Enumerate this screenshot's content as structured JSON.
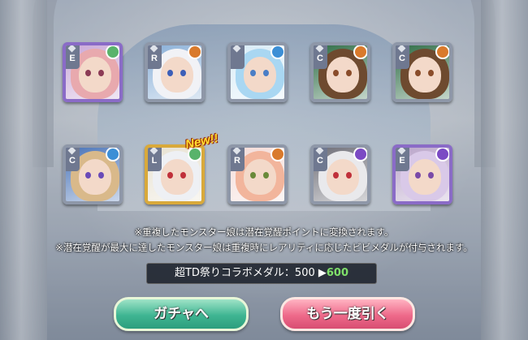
{
  "cards": [
    {
      "rarity": "E",
      "element": "wind",
      "frame": "purple",
      "hair": "#e8a9ae",
      "eye": "#8b3a55",
      "bg": "#c9a8d8",
      "elem_color": "#59b36b"
    },
    {
      "rarity": "R",
      "element": "earth",
      "frame": "silver",
      "hair": "#f1f2f6",
      "eye": "#3c5fb8",
      "bg": "#8ab0d8",
      "elem_color": "#d97a2c"
    },
    {
      "rarity": "",
      "element": "water",
      "frame": "silver",
      "hair": "#a9d7f2",
      "eye": "#4a7ec6",
      "bg": "#d9ecf7",
      "elem_color": "#3c8fd6"
    },
    {
      "rarity": "C",
      "element": "earth",
      "frame": "silver",
      "hair": "#6e4a2f",
      "eye": "#8a4c2a",
      "bg": "#2f6d46",
      "elem_color": "#d97a2c"
    },
    {
      "rarity": "C",
      "element": "earth",
      "frame": "silver",
      "hair": "#6e4a2f",
      "eye": "#8a4c2a",
      "bg": "#2f6d46",
      "elem_color": "#d97a2c"
    },
    {
      "rarity": "C",
      "element": "water",
      "frame": "silver",
      "hair": "#d9b98a",
      "eye": "#6a4ab8",
      "bg": "#4a74b8",
      "elem_color": "#3c8fd6"
    },
    {
      "rarity": "L",
      "element": "wind",
      "frame": "gold",
      "hair": "#eef0f4",
      "eye": "#c0303a",
      "bg": "#e8e2d2",
      "elem_color": "#59b36b"
    },
    {
      "rarity": "R",
      "element": "earth",
      "frame": "silver",
      "hair": "#f2b59c",
      "eye": "#6a8a3a",
      "bg": "#f4dcd8",
      "elem_color": "#d97a2c"
    },
    {
      "rarity": "C",
      "element": "dark",
      "frame": "silver",
      "hair": "#e9e9ec",
      "eye": "#c0303a",
      "bg": "#6f6f78",
      "elem_color": "#7b4ac4"
    },
    {
      "rarity": "E",
      "element": "dark",
      "frame": "purple",
      "hair": "#d9c9e8",
      "eye": "#7a4aa8",
      "bg": "#b9a4c9",
      "elem_color": "#7b4ac4"
    }
  ],
  "new_badge": "New!!",
  "notes": {
    "line1": "※重複したモンスター娘は潜在覚醒ポイントに変換されます。",
    "line2": "※潜在覚醒が最大に達したモンスター娘は重複時にレアリティに応じたビビメダルが付与されます。"
  },
  "medal": {
    "label": "超TD祭りコラボメダル：",
    "before": "500",
    "arrow": "▶",
    "after": "600"
  },
  "buttons": {
    "gacha": "ガチャへ",
    "again": "もう一度引く"
  }
}
